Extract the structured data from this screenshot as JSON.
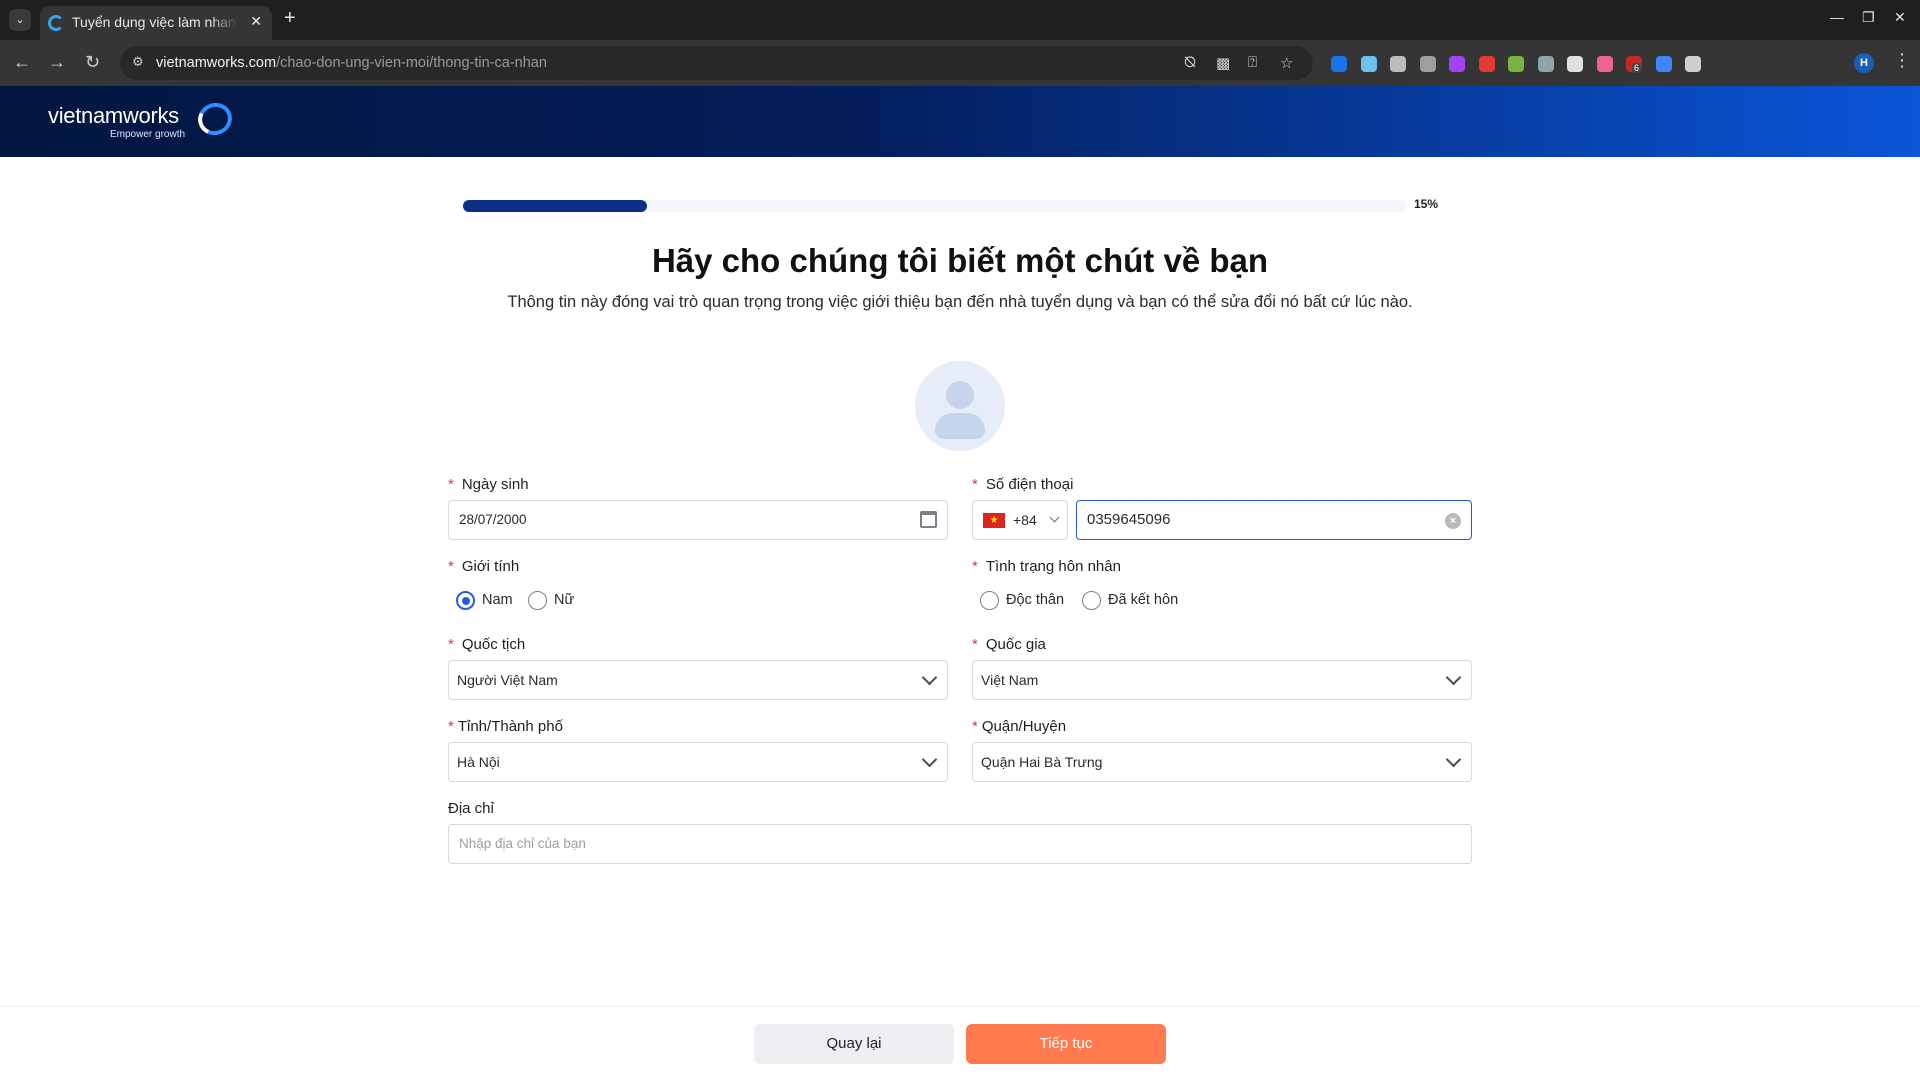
{
  "browser": {
    "tab_title": "Tuyển dụng việc làm nhanh",
    "url_host": "vietnamworks.com",
    "url_path": "/chao-don-ung-vien-moi/thong-tin-ca-nhan",
    "extension_badge": "6",
    "profile_initial": "H",
    "extension_colors": [
      "#1a73e8",
      "#6cc3e8",
      "#bdbdbd",
      "#9e9e9e",
      "#a142f4",
      "#e53935",
      "#7cb342",
      "#90a4ae",
      "#e0e0e0",
      "#f06292",
      "#c62828",
      "#4285f4",
      "#cfcfcf"
    ]
  },
  "site": {
    "logo_text": "vietnamworks",
    "logo_tagline": "Empower growth"
  },
  "progress": {
    "percent_label": "15%",
    "fraction": 0.15
  },
  "page": {
    "title": "Hãy cho chúng tôi biết một chút về bạn",
    "subtitle": "Thông tin này đóng vai trò quan trọng trong việc giới thiệu bạn đến nhà tuyển dụng và bạn có thể sửa đổi nó bất cứ lúc nào."
  },
  "form": {
    "dob": {
      "label": "Ngày sinh",
      "value": "28/07/2000"
    },
    "phone": {
      "label": "Số điện thoại",
      "country_code": "+84",
      "value": "0359645096"
    },
    "gender": {
      "label": "Giới tính",
      "options": [
        "Nam",
        "Nữ"
      ],
      "selected": "Nam"
    },
    "marital": {
      "label": "Tình trạng hôn nhân",
      "options": [
        "Độc thân",
        "Đã kết hôn"
      ],
      "selected": ""
    },
    "nationality": {
      "label": "Quốc tịch",
      "value": "Người Việt Nam"
    },
    "country": {
      "label": "Quốc gia",
      "value": "Việt Nam"
    },
    "province": {
      "label": "Tỉnh/Thành phố",
      "value": "Hà Nội"
    },
    "district": {
      "label": "Quận/Huyện",
      "value": "Quận Hai Bà Trưng"
    },
    "address": {
      "label": "Địa chỉ",
      "placeholder": "Nhập địa chỉ của bạn",
      "value": ""
    }
  },
  "footer": {
    "back_label": "Quay lại",
    "next_label": "Tiếp tục"
  },
  "colors": {
    "accent": "#2a5bd7",
    "progress": "#0d2e87",
    "primary_button": "#ff7a4f",
    "required": "#e53935"
  }
}
